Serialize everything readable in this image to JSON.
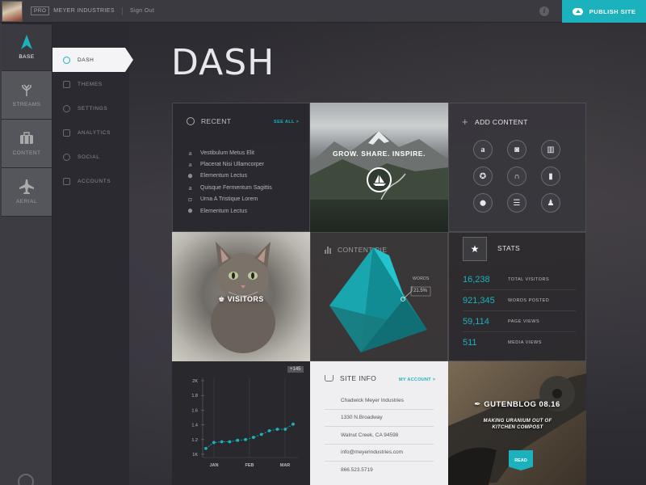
{
  "topbar": {
    "pro_badge": "PRO",
    "company": "MEYER INDUSTRIES",
    "sign_out": "Sign Out",
    "info_icon": "i",
    "publish_label": "PUBLISH SITE"
  },
  "rail": [
    {
      "label": "BASE",
      "icon": "navigation-arrow-icon",
      "active": true
    },
    {
      "label": "STREAMS",
      "icon": "tree-icon",
      "active": false
    },
    {
      "label": "CONTENT",
      "icon": "briefcase-icon",
      "active": false
    },
    {
      "label": "AERIAL",
      "icon": "airplane-icon",
      "active": false
    }
  ],
  "subnav": [
    {
      "label": "DASH",
      "icon": "crosshair-icon",
      "active": true
    },
    {
      "label": "THEMES",
      "icon": "user-icon",
      "active": false
    },
    {
      "label": "SETTINGS",
      "icon": "gear-icon",
      "active": false
    },
    {
      "label": "ANALYTICS",
      "icon": "pulse-icon",
      "active": false
    },
    {
      "label": "SOCIAL",
      "icon": "share-icon",
      "active": false
    },
    {
      "label": "ACCOUNTS",
      "icon": "card-icon",
      "active": false
    }
  ],
  "page_title": "DASH",
  "recent": {
    "title": "RECENT",
    "see_all": "SEE ALL >",
    "items": [
      {
        "icon": "amazon-icon",
        "glyph": "a",
        "label": "Vestibulum Metus Elit"
      },
      {
        "icon": "amazon-icon",
        "glyph": "a",
        "label": "Placerat Nisi Ullamcorper"
      },
      {
        "icon": "map-pin-icon",
        "glyph": "⬤",
        "label": "Elementum Lectus"
      },
      {
        "icon": "amazon-icon",
        "glyph": "a",
        "label": "Quisque Fermentum Sagittis"
      },
      {
        "icon": "camera-icon",
        "glyph": "◘",
        "label": "Urna A Tristique Lorem"
      },
      {
        "icon": "map-pin-icon",
        "glyph": "⬤",
        "label": "Elementum Lectus"
      }
    ]
  },
  "hero": {
    "tagline": "GROW. SHARE. INSPIRE."
  },
  "add_content": {
    "title": "ADD CONTENT",
    "buttons": [
      {
        "icon": "amazon-icon",
        "glyph": "a"
      },
      {
        "icon": "camera-icon",
        "glyph": "◙"
      },
      {
        "icon": "book-icon",
        "glyph": "▥"
      },
      {
        "icon": "film-reel-icon",
        "glyph": "✪"
      },
      {
        "icon": "headphones-icon",
        "glyph": "∩"
      },
      {
        "icon": "document-icon",
        "glyph": "▮"
      },
      {
        "icon": "map-pin-icon",
        "glyph": "⬤"
      },
      {
        "icon": "list-icon",
        "glyph": "☰"
      },
      {
        "icon": "person-icon",
        "glyph": "♟"
      }
    ]
  },
  "visitors_tile": {
    "label": "VISITORS"
  },
  "content_pie": {
    "title": "CONTENT PIE",
    "callout_label": "WORDS",
    "callout_value": "21.5%"
  },
  "stats": {
    "title": "STATS",
    "rows": [
      {
        "value": "16,238",
        "label": "TOTAL VISITORS"
      },
      {
        "value": "921,345",
        "label": "WORDS POSTED"
      },
      {
        "value": "59,114",
        "label": "PAGE VIEWS"
      },
      {
        "value": "511",
        "label": "MEDIA VIEWS"
      }
    ]
  },
  "chart_data": {
    "type": "line",
    "badge": "+145",
    "x_ticks": [
      "JAN",
      "FEB",
      "MAR"
    ],
    "y_ticks": [
      "1K",
      "1.2",
      "1.4",
      "1.6",
      "1.8",
      "2K"
    ],
    "ylim": [
      1.0,
      2.0
    ],
    "x": [
      0,
      1,
      2,
      3,
      4,
      5,
      6,
      7,
      8,
      9,
      10,
      11
    ],
    "values": [
      1.08,
      1.16,
      1.17,
      1.17,
      1.19,
      1.2,
      1.23,
      1.27,
      1.32,
      1.34,
      1.34,
      1.41
    ],
    "grid": "vertical month lines"
  },
  "site_info": {
    "title": "SITE INFO",
    "my_account": "MY ACCOUNT >",
    "lines": [
      "Chadwick Meyer Industries",
      "1330 N.Broadway",
      "Walnut Creek, CA 94598",
      "info@meyerindustries.com",
      "866.523.5719"
    ]
  },
  "gutenblog": {
    "title": "GUTENBLOG 08.16",
    "subtitle": "MAKING URANIUM OUT OF KITCHEN COMPOST",
    "read_label": "READ"
  },
  "colors": {
    "accent": "#1bb2bd",
    "sidebar": "#3c3c42",
    "subnav": "#2a2a30"
  }
}
